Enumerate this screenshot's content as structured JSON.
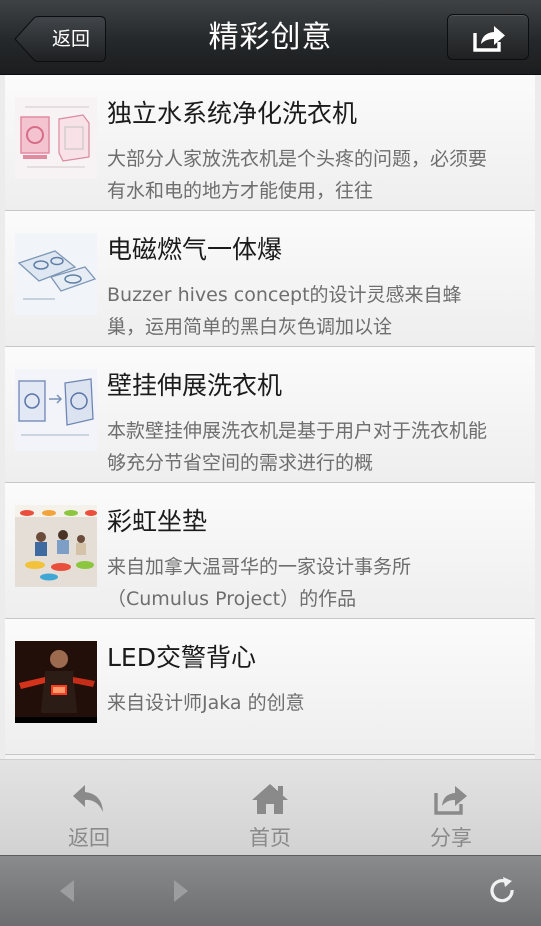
{
  "header": {
    "title": "精彩创意",
    "back_label": "返回"
  },
  "items": [
    {
      "title": "独立水系统净化洗衣机",
      "desc": "大部分人家放洗衣机是个头疼的问题，必须要有水和电的地方才能使用，往往",
      "thumb_icon": "washing-machine-sketch-image"
    },
    {
      "title": "电磁燃气一体爆",
      "desc": "Buzzer hives concept的设计灵感来自蜂巢，运用简单的黑白灰色调加以诠",
      "thumb_icon": "stove-sketch-image"
    },
    {
      "title": "壁挂伸展洗衣机",
      "desc": "本款壁挂伸展洗衣机是基于用户对于洗衣机能够充分节省空间的需求进行的概",
      "thumb_icon": "wall-washer-sketch-image"
    },
    {
      "title": "彩虹坐垫",
      "desc": "来自加拿大温哥华的一家设计事务所（Cumulus Project）的作品",
      "thumb_icon": "rainbow-cushion-photo"
    },
    {
      "title": "LED交警背心",
      "desc": "来自设计师Jaka 的创意",
      "thumb_icon": "led-vest-photo"
    }
  ],
  "tabbar": {
    "back_label": "返回",
    "home_label": "首页",
    "share_label": "分享"
  },
  "colors": {
    "header_bg": "#25282a",
    "tab_label": "#8a8a8a",
    "title_text": "#1b1b1b",
    "desc_text": "#6e6e6e"
  }
}
